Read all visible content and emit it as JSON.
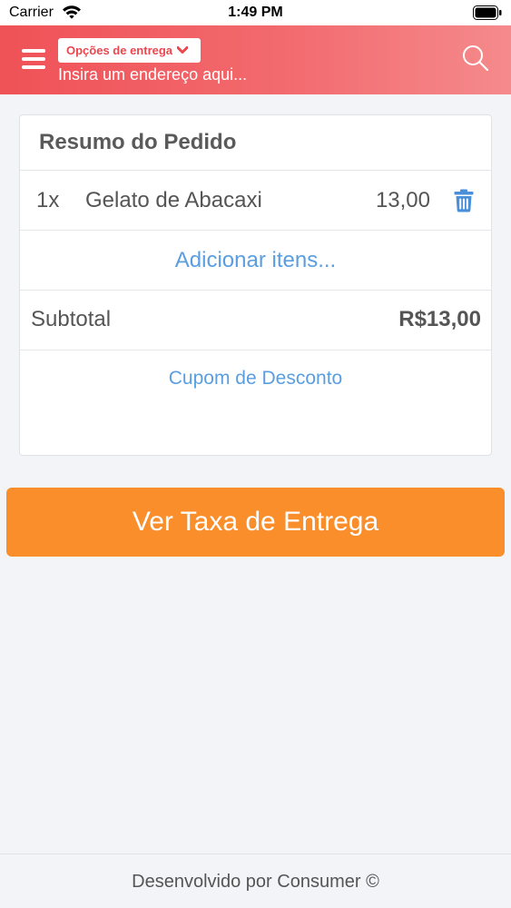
{
  "status_bar": {
    "carrier": "Carrier",
    "time": "1:49 PM"
  },
  "header": {
    "delivery_options_label": "Opções de entrega",
    "address_placeholder": "Insira um endereço aqui..."
  },
  "order_summary": {
    "title": "Resumo do Pedido",
    "items": [
      {
        "qty": "1x",
        "name": "Gelato de Abacaxi",
        "price": "13,00"
      }
    ],
    "add_items_label": "Adicionar itens...",
    "subtotal_label": "Subtotal",
    "subtotal_value": "R$13,00",
    "coupon_label": "Cupom de Desconto"
  },
  "actions": {
    "delivery_fee_button": "Ver Taxa de Entrega"
  },
  "footer": {
    "text": "Desenvolvido por Consumer ©"
  },
  "colors": {
    "header_start": "#ef5257",
    "header_end": "#f58a8c",
    "link_blue": "#5a9ee0",
    "button_orange": "#fa8e2a"
  },
  "icons": [
    "wifi-icon",
    "battery-icon",
    "menu-icon",
    "chevron-down-icon",
    "search-icon",
    "trash-icon"
  ]
}
